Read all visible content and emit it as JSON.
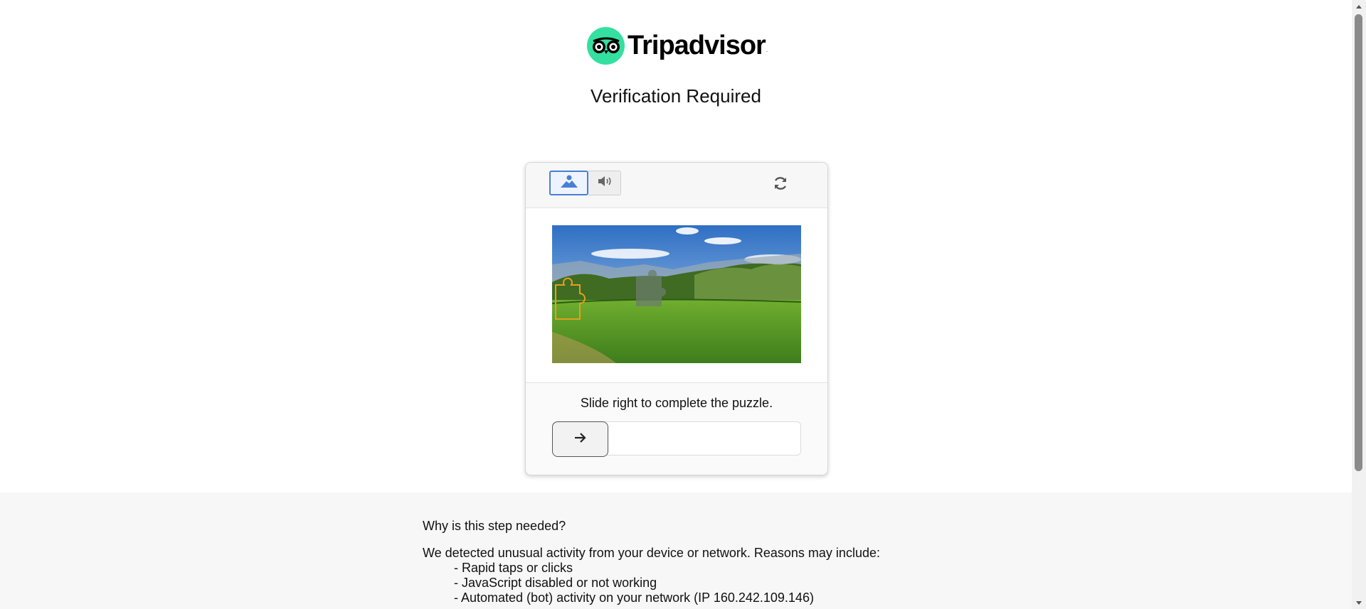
{
  "header": {
    "brand_name": "Tripadvisor",
    "brand_tm": ".",
    "title": "Verification Required",
    "brand_color": "#34e0a1"
  },
  "captcha": {
    "modes": [
      {
        "name": "image-challenge",
        "icon": "landscape-icon",
        "active": true
      },
      {
        "name": "audio-challenge",
        "icon": "speaker-icon",
        "active": false
      }
    ],
    "refresh_icon": "refresh-icon",
    "image_description": "green meadow landscape with puzzle piece slot",
    "instruction": "Slide right to complete the puzzle.",
    "slider_icon": "arrow-right-icon",
    "slider_progress": 0,
    "accent_color": "#4a7fd6"
  },
  "info": {
    "question": "Why is this step needed?",
    "paragraph": "We detected unusual activity from your device or network. Reasons may include:",
    "reasons": [
      "- Rapid taps or clicks",
      "- JavaScript disabled or not working",
      "- Automated (bot) activity on your network (IP 160.242.109.146)"
    ]
  }
}
